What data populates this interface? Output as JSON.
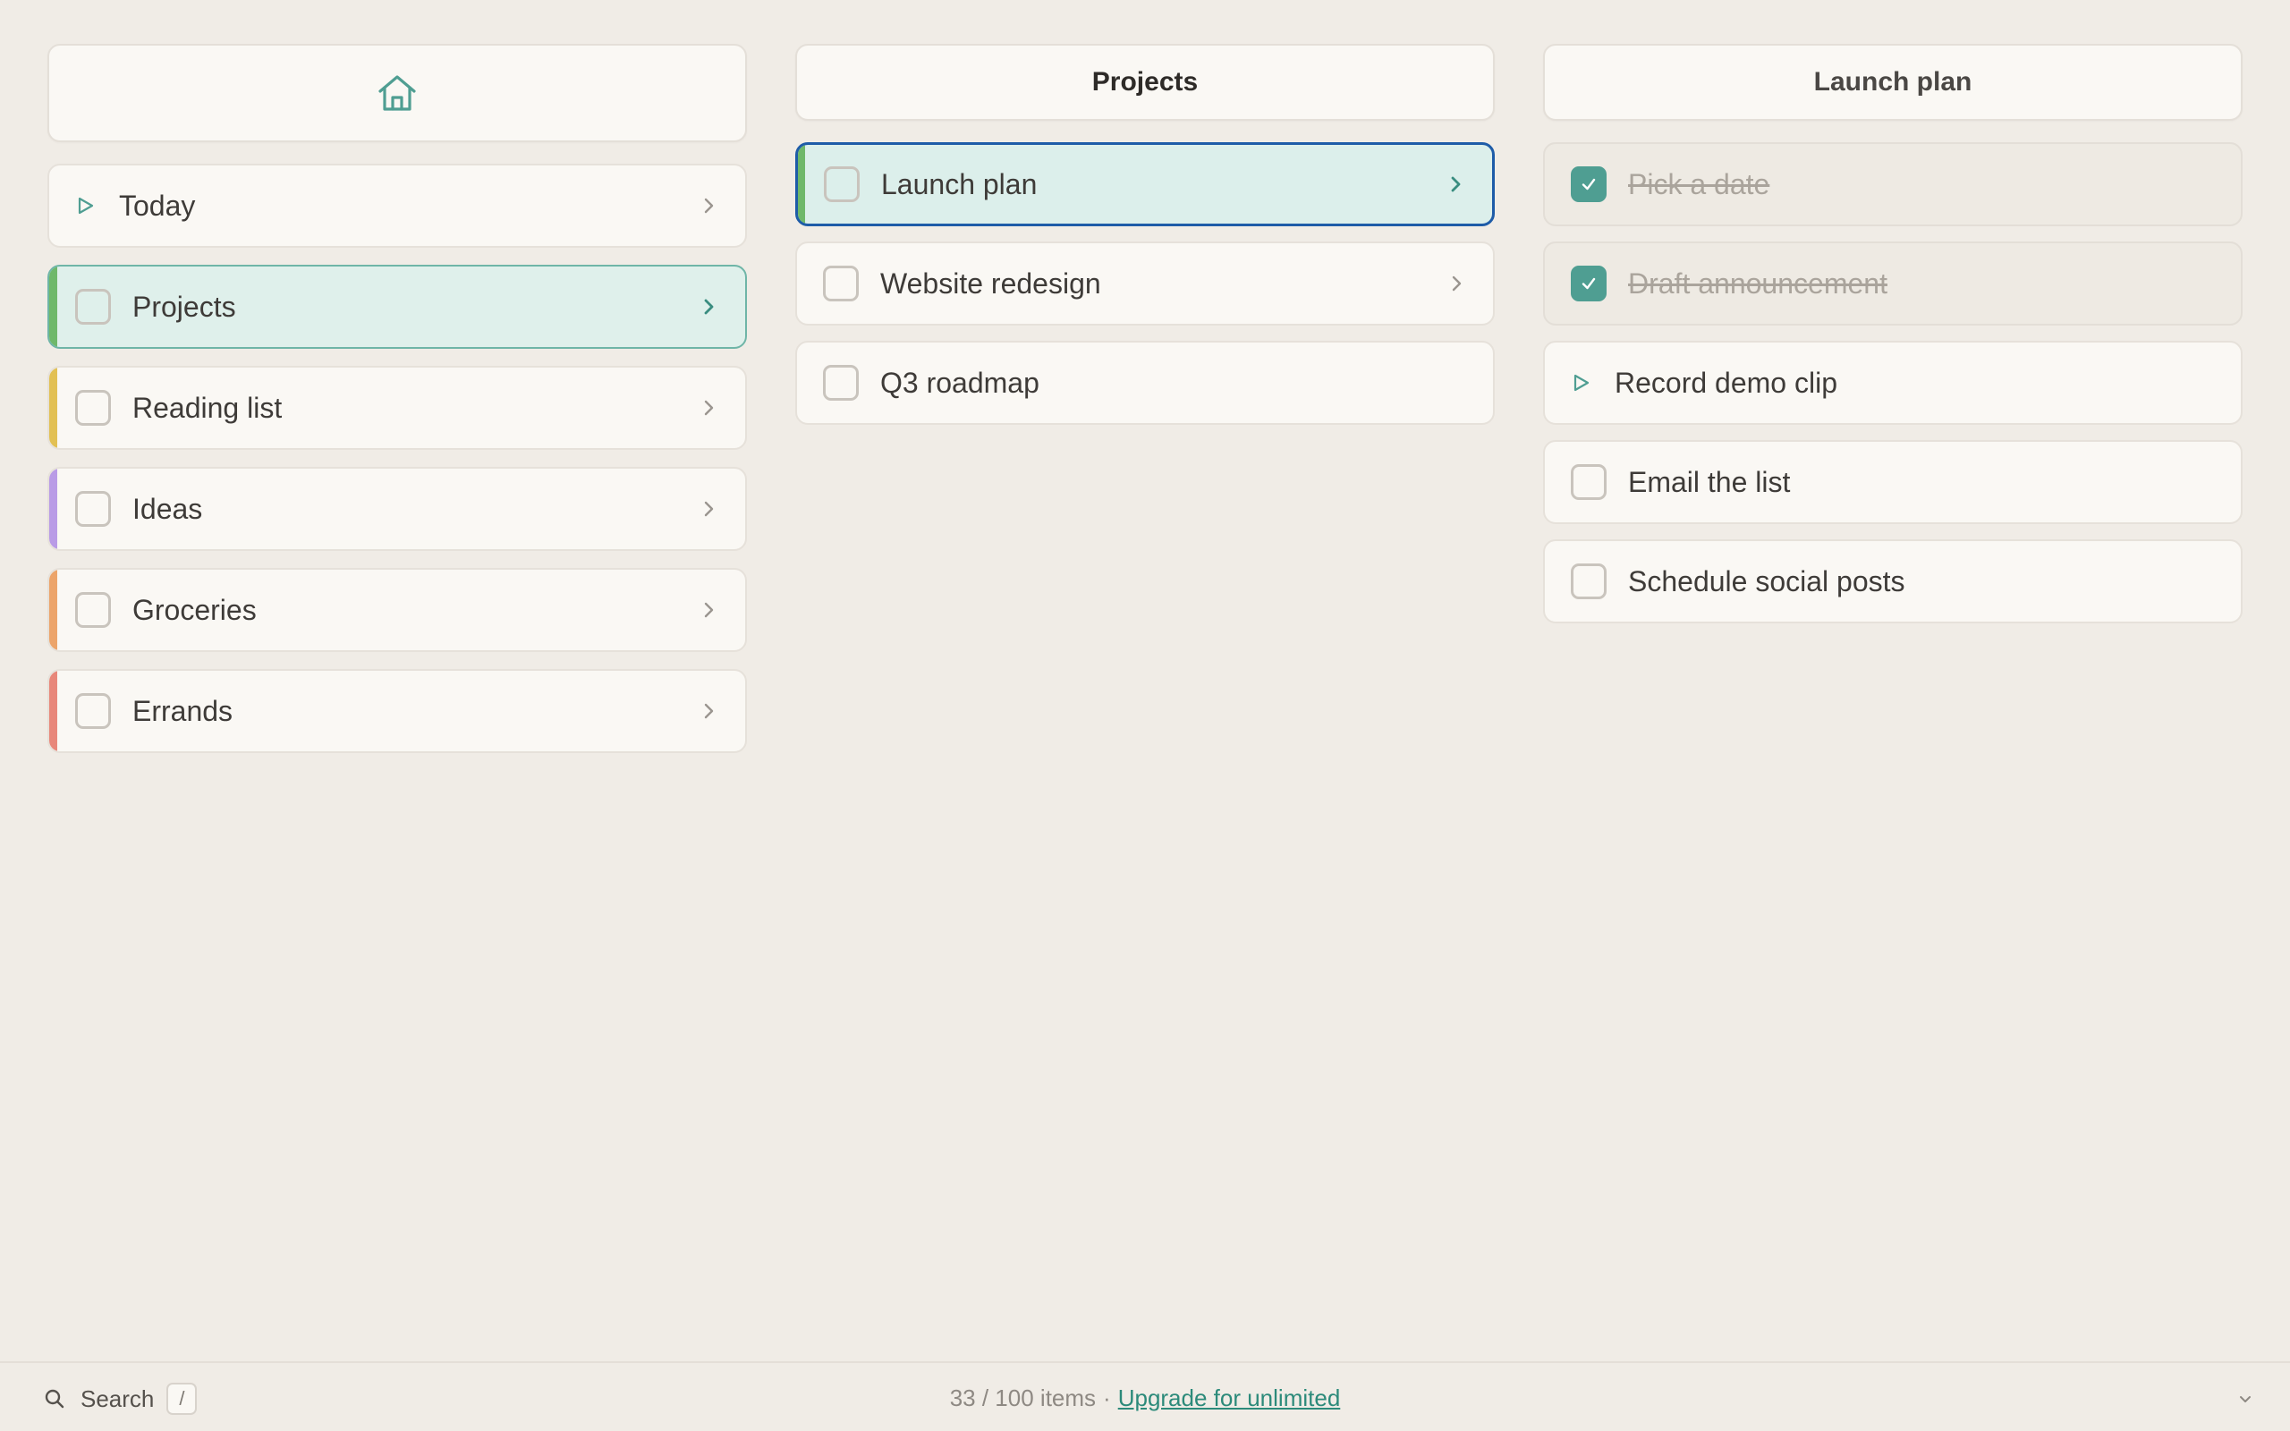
{
  "colors": {
    "accent": "#4f9e92",
    "focus_ring": "#1e5ca8",
    "stripe_green": "#6fb86a",
    "stripe_yellow": "#e2c053",
    "stripe_purple": "#b99be6",
    "stripe_orange": "#eca46a",
    "stripe_red": "#e8877a"
  },
  "home": {
    "icon": "home-icon"
  },
  "sidebar": {
    "items": [
      {
        "label": "Today",
        "icon": "play-icon"
      },
      {
        "label": "Projects",
        "selected": true
      },
      {
        "label": "Reading list"
      },
      {
        "label": "Ideas"
      },
      {
        "label": "Groceries"
      },
      {
        "label": "Errands"
      }
    ]
  },
  "projects": {
    "title": "Projects",
    "items": [
      {
        "label": "Launch plan",
        "focused": true
      },
      {
        "label": "Website redesign"
      },
      {
        "label": "Q3 roadmap"
      }
    ]
  },
  "launch_plan": {
    "title": "Launch plan",
    "items": [
      {
        "label": "Pick a date",
        "done": true
      },
      {
        "label": "Draft announcement",
        "done": true
      },
      {
        "label": "Record demo clip",
        "icon": "play-icon"
      },
      {
        "label": "Email the list"
      },
      {
        "label": "Schedule social posts"
      }
    ]
  },
  "footer": {
    "search_label": "Search",
    "search_shortcut": "/",
    "item_count": "33 / 100 items",
    "separator": "·",
    "upgrade_link": "Upgrade for unlimited"
  }
}
